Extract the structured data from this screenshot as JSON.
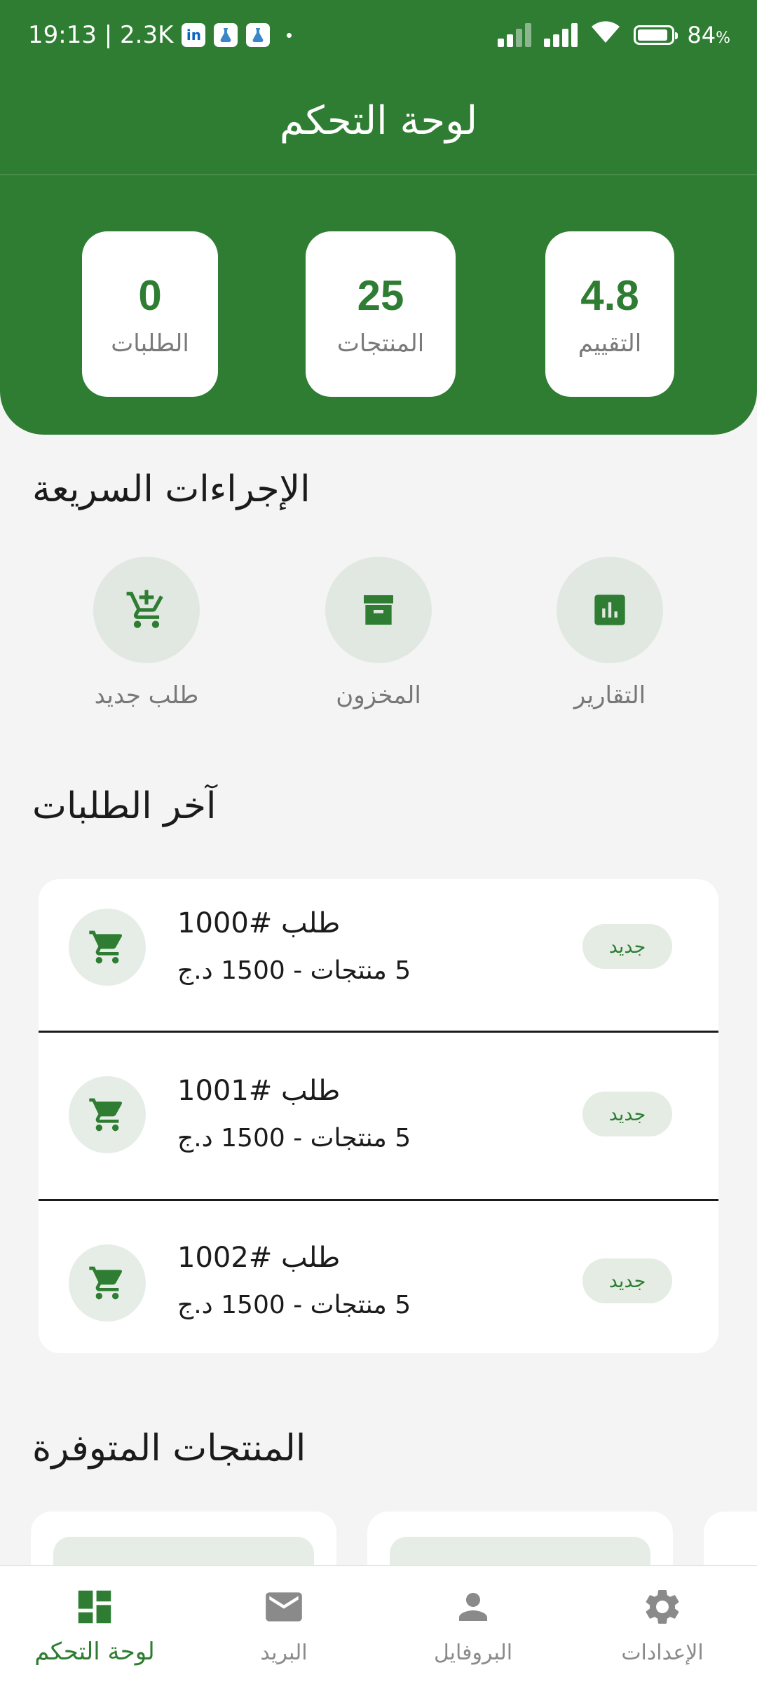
{
  "status_bar": {
    "time_info": "19:13 | 2.3K",
    "app_icon_linkedin": "in",
    "battery": "84",
    "battery_unit": "%"
  },
  "header": {
    "title": "لوحة التحكم",
    "stats": [
      {
        "value": "4.8",
        "label": "التقييم"
      },
      {
        "value": "25",
        "label": "المنتجات"
      },
      {
        "value": "0",
        "label": "الطلبات"
      }
    ]
  },
  "quick_actions": {
    "title": "الإجراءات السريعة",
    "items": [
      {
        "label": "التقارير",
        "icon": "reports-icon"
      },
      {
        "label": "المخزون",
        "icon": "inventory-icon"
      },
      {
        "label": "طلب جديد",
        "icon": "add-cart-icon"
      }
    ]
  },
  "recent_orders": {
    "title": "آخر الطلبات",
    "orders": [
      {
        "title": "طلب #1000",
        "subtitle": "5 منتجات - 1500 د.ج",
        "status": "جديد"
      },
      {
        "title": "طلب #1001",
        "subtitle": "5 منتجات - 1500 د.ج",
        "status": "جديد"
      },
      {
        "title": "طلب #1002",
        "subtitle": "5 منتجات - 1500 د.ج",
        "status": "جديد"
      }
    ]
  },
  "products": {
    "title": "المنتجات المتوفرة"
  },
  "bottom_nav": {
    "items": [
      {
        "label": "لوحة التحكم",
        "icon": "dashboard-icon",
        "active": true
      },
      {
        "label": "البريد",
        "icon": "mail-icon",
        "active": false
      },
      {
        "label": "البروفايل",
        "icon": "person-icon",
        "active": false
      },
      {
        "label": "الإعدادات",
        "icon": "settings-icon",
        "active": false
      }
    ]
  },
  "colors": {
    "primary": "#2e7d32",
    "background": "#f4f4f4",
    "icon_circle": "#e1e8e1",
    "muted_text": "#7a7a7a"
  }
}
